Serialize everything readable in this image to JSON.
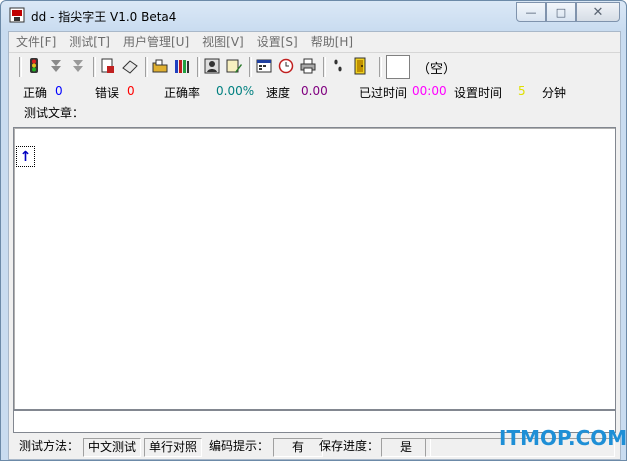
{
  "window": {
    "title": "dd - 指尖字王 V1.0 Beta4",
    "controls": {
      "minimize": "—",
      "maximize": "□",
      "close": "✕"
    }
  },
  "menu": [
    "文件[F]",
    "测试[T]",
    "用户管理[U]",
    "视图[V]",
    "设置[S]",
    "帮助[H]"
  ],
  "toolbar": {
    "buttons": [
      {
        "name": "traffic-light-icon"
      },
      {
        "name": "down-arrow-gray-icon"
      },
      {
        "name": "down-arrow-gray-2-icon"
      },
      {
        "name": "document-icon"
      },
      {
        "name": "eraser-icon"
      },
      {
        "name": "open-folder-icon"
      },
      {
        "name": "books-icon"
      },
      {
        "name": "user-photo-icon"
      },
      {
        "name": "edit-user-icon"
      },
      {
        "name": "calendar-icon"
      },
      {
        "name": "clock-icon"
      },
      {
        "name": "printer-icon"
      },
      {
        "name": "footprints-icon"
      },
      {
        "name": "exit-door-icon"
      }
    ],
    "empty_label": "（空）"
  },
  "stats": {
    "correct_label": "正确",
    "correct_value": "0",
    "errors_label": "错误",
    "errors_value": "0",
    "accuracy_label": "正确率",
    "accuracy_value": "0.00%",
    "speed_label": "速度",
    "speed_value": "0.00",
    "elapsed_label": "已过时间",
    "elapsed_value": "00:00",
    "set_time_label": "设置时间",
    "set_time_value": "5",
    "set_time_unit": "分钟",
    "colors": {
      "correct": "#0000ff",
      "errors": "#ff0000",
      "accuracy": "#008080",
      "speed": "#800080",
      "elapsed": "#ff00ff",
      "set_time": "#e0e000"
    }
  },
  "article_label": "测试文章：",
  "cursor_glyph": "↑",
  "statusbar": {
    "method_label": "测试方法：",
    "method_value": "中文测试",
    "mode_value": "单行对照",
    "encoding_label": "编码提示：",
    "encoding_value": "有",
    "save_label": "保存进度：",
    "save_value": "是"
  },
  "watermark": "ITMOP.COM"
}
